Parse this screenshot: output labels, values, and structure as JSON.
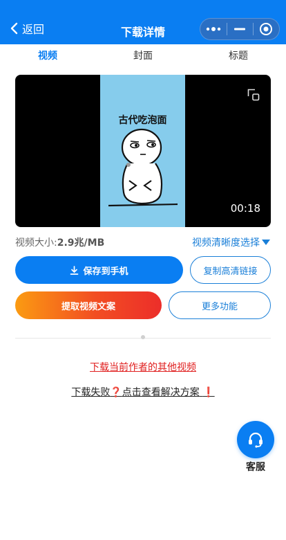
{
  "navbar": {
    "back_label": "返回",
    "title": "下载详情",
    "more_icon": "more-dots-icon",
    "minimize_icon": "minimize-icon",
    "close_icon": "target-close-icon"
  },
  "tabs": [
    {
      "label": "视频",
      "active": true
    },
    {
      "label": "封面",
      "active": false
    },
    {
      "label": "标题",
      "active": false
    }
  ],
  "player": {
    "caption": "古代吃泡面",
    "duration": "00:18",
    "pip_icon": "picture-in-picture-icon"
  },
  "info": {
    "size_label": "视频大小:",
    "size_value": "2.9兆/MB",
    "quality_label": "视频清晰度选择"
  },
  "buttons": {
    "save_label": "保存到手机",
    "copy_label": "复制高清链接",
    "extract_label": "提取视频文案",
    "more_label": "更多功能"
  },
  "links": {
    "other_videos": "下载当前作者的其他视频",
    "fail_prefix": "下载失败",
    "fail_question_mark": "❓",
    "fail_text": "点击查看解决方案",
    "fail_exclaim": "❗"
  },
  "service": {
    "label": "客服",
    "icon": "headset-icon"
  },
  "colors": {
    "primary": "#0a7ef2",
    "accent_red": "#e02020",
    "gradient_start": "#fb9b12",
    "gradient_end": "#ec2e2a"
  }
}
